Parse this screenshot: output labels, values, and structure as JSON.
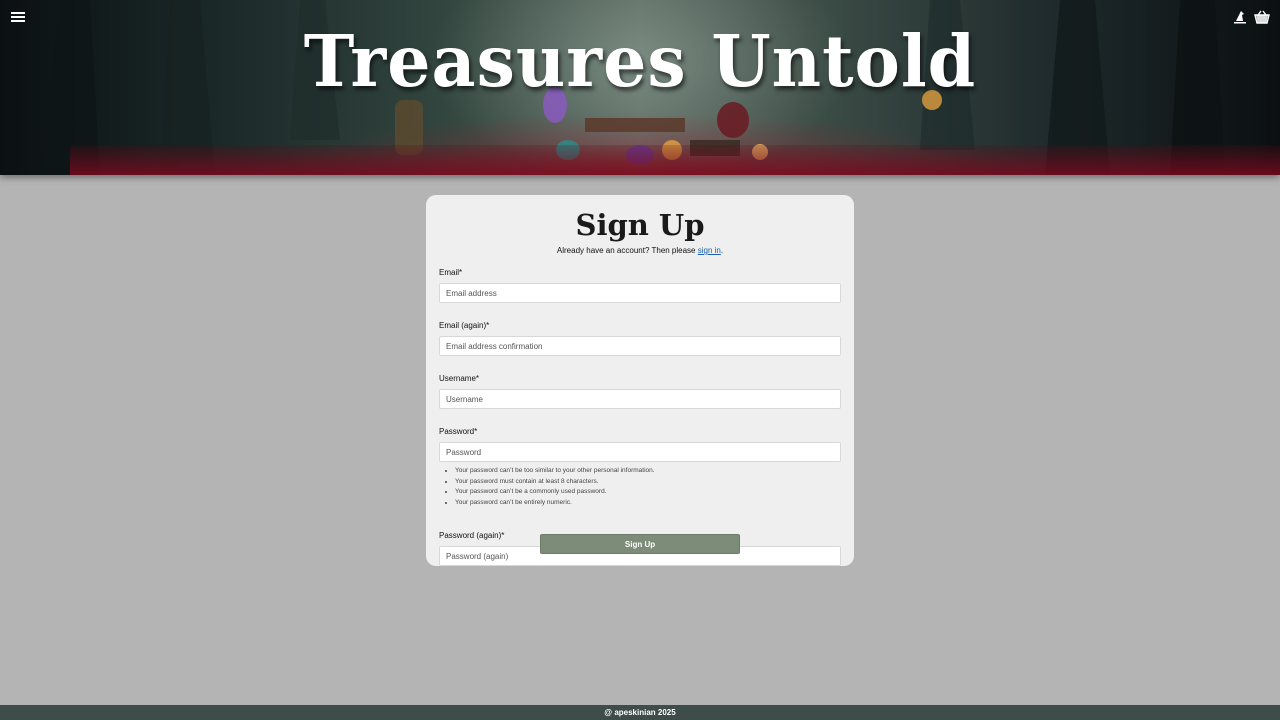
{
  "header": {
    "title": "Treasures Untold",
    "menu_icon": "hamburger-menu-icon",
    "profile_icon": "wizard-hat-icon",
    "cart_icon": "basket-icon"
  },
  "form": {
    "title": "Sign Up",
    "signin_prefix": "Already have an account? Then please ",
    "signin_link": "sign in",
    "signin_suffix": ".",
    "fields": [
      {
        "label": "Email*",
        "placeholder": "Email address",
        "value": ""
      },
      {
        "label": "Email (again)*",
        "placeholder": "Email address confirmation",
        "value": ""
      },
      {
        "label": "Username*",
        "placeholder": "Username",
        "value": ""
      },
      {
        "label": "Password*",
        "placeholder": "Password",
        "value": ""
      },
      {
        "label": "Password (again)*",
        "placeholder": "Password (again)",
        "value": ""
      }
    ],
    "password_help": [
      "Your password can’t be too similar to your other personal information.",
      "Your password must contain at least 8 characters.",
      "Your password can’t be a commonly used password.",
      "Your password can’t be entirely numeric."
    ],
    "submit_label": "Sign Up"
  },
  "footer": {
    "text": "@ apeskinian 2025"
  },
  "colors": {
    "page_bg": "#b4b4b4",
    "card_bg": "#efefef",
    "button": "#7d8c78",
    "footer": "#3f4d4a",
    "link": "#1a5fb4"
  }
}
